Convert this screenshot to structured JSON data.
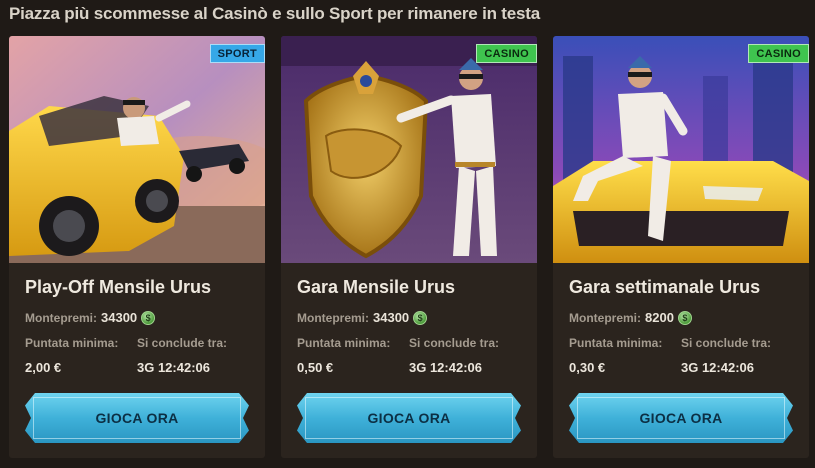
{
  "headline": "Piazza più scommesse al Casinò e sullo Sport per rimanere in testa",
  "labels": {
    "prize": "Montepremi:",
    "min_bet": "Puntata minima:",
    "ends_in": "Si conclude tra:"
  },
  "cards": [
    {
      "tag": "SPORT",
      "title": "Play-Off Mensile Urus",
      "prize": "34300",
      "min_bet": "2,00 €",
      "ends_in": "3G 12:42:06",
      "button": "GIOCA ORA"
    },
    {
      "tag": "CASINO",
      "title": "Gara Mensile Urus",
      "prize": "34300",
      "min_bet": "0,50 €",
      "ends_in": "3G 12:42:06",
      "button": "GIOCA ORA"
    },
    {
      "tag": "CASINO",
      "title": "Gara settimanale Urus",
      "prize": "8200",
      "min_bet": "0,30 €",
      "ends_in": "3G 12:42:06",
      "button": "GIOCA ORA"
    }
  ],
  "colors": {
    "background": "#1f1a16",
    "card": "#2b241e",
    "sport_tag": "#36a8e8",
    "casino_tag": "#3fc44f",
    "button": "#3fb1d9"
  },
  "icons": [
    "coin-icon"
  ]
}
